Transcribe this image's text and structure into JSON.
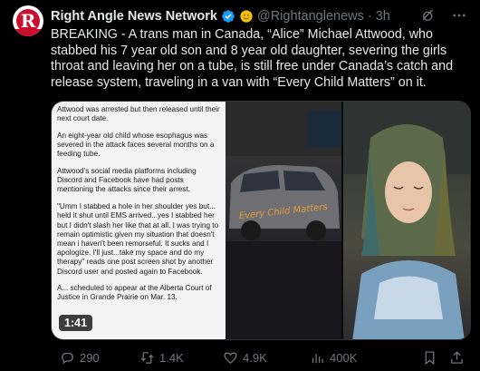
{
  "post": {
    "author_name": "Right Angle News Network",
    "handle": "@Rightanglenews",
    "separator": "·",
    "time": "3h",
    "body": "BREAKING - A trans man in Canada, “Alice” Michael Attwood, who stabbed his 7 year old son and 8 year old daughter, severing the girls throat and leaving her on a tube, is still free under Canada’s catch and release system, traveling in a van with “Every Child Matters” on it.",
    "avatar_letter": "R"
  },
  "media": {
    "doc_paragraphs": [
      "Attwood was arrested but then released until their next court date.",
      "An eight-year old child whose esophagus was severed in the attack faces several months on a feeding tube.",
      "Attwood’s social media platforms including Discord and Facebook have had posts mentioning the attacks since their arrest.",
      "\"Umm I stabbed a hole in her shoulder yes but... held it shut until EMS arrived...yes I stabbed her but I didn't slash her like that at all. I was trying to remain optimistic given my situation that doesn't mean i haven't been remorseful. It sucks and I apologize. I'll just...take my space and do my therapy\" reads one post screen shot by another Discord user and posted again to Facebook.",
      "A... scheduled to appear at the Alberta Court of Justice in Grande Prairie on Mar. 13."
    ],
    "van_text": "Every Child Matters",
    "duration": "1:41"
  },
  "actions": {
    "replies": "290",
    "reposts": "1.4K",
    "likes": "4.9K",
    "views": "400K"
  },
  "colors": {
    "background": "#000000",
    "text": "#e7e9ea",
    "muted": "#71767b",
    "verified": "#1d9bf0",
    "brand_red": "#c8102e"
  },
  "icons": [
    "verified-badge-icon",
    "smiley-badge-icon",
    "grok-icon",
    "more-icon",
    "reply-icon",
    "repost-icon",
    "like-icon",
    "views-icon",
    "bookmark-icon",
    "share-icon"
  ]
}
